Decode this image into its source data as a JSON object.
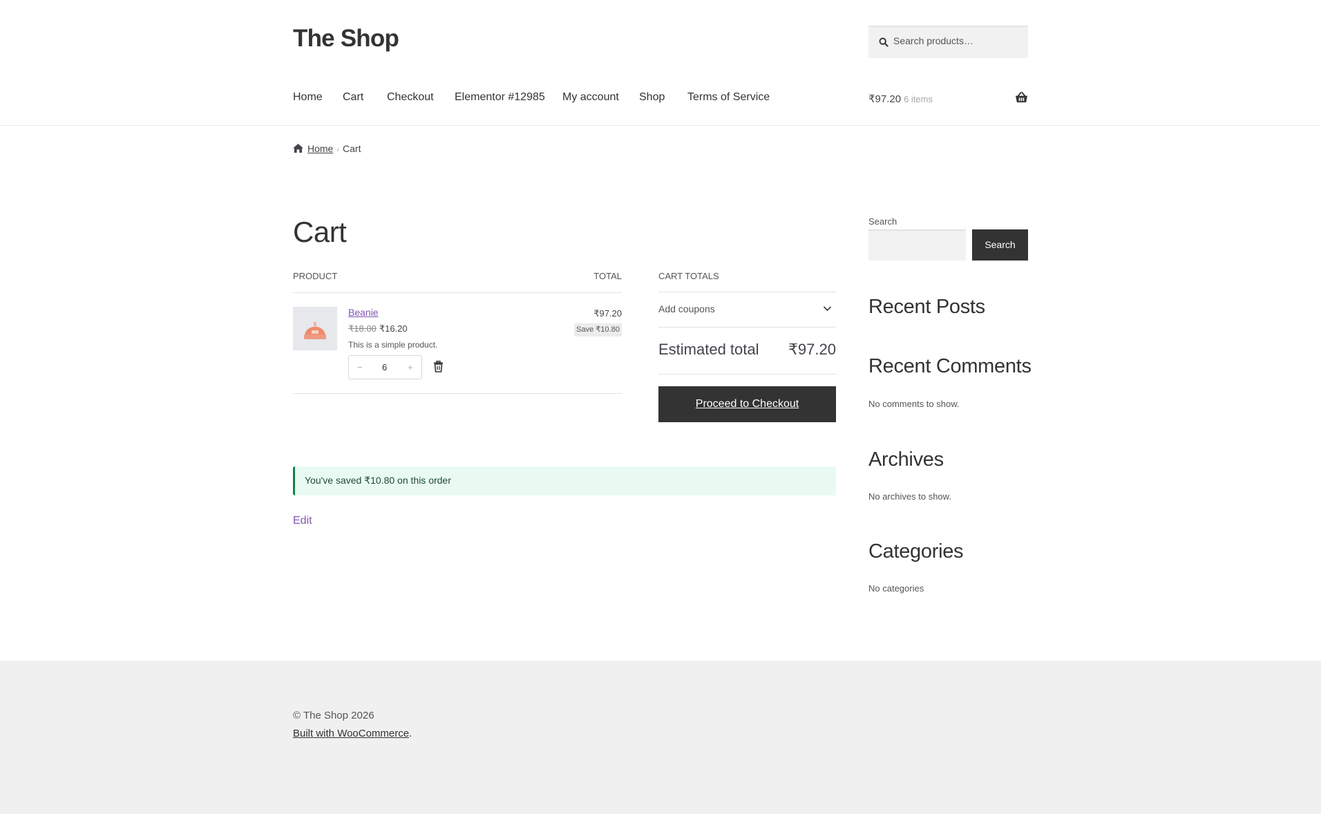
{
  "header": {
    "site_title": "The Shop",
    "search_placeholder": "Search products…",
    "nav": [
      "Home",
      "Cart",
      "Checkout",
      "Elementor #12985",
      "My account",
      "Shop",
      "Terms of Service"
    ],
    "mini_cart": {
      "amount": "₹97.20",
      "count": "6 items"
    }
  },
  "breadcrumb": {
    "home": "Home",
    "current": "Cart"
  },
  "cart": {
    "title": "Cart",
    "col_product": "PRODUCT",
    "col_total": "TOTAL",
    "item": {
      "name": "Beanie",
      "regular_price": "₹18.00",
      "sale_price": "₹16.20",
      "description": "This is a simple product.",
      "quantity": "6",
      "qty_minus": "−",
      "qty_plus": "+",
      "line_total": "₹97.20",
      "save_badge": "Save ₹10.80"
    }
  },
  "totals": {
    "heading": "CART TOTALS",
    "coupons": "Add coupons",
    "estimated_label": "Estimated total",
    "estimated_value": "₹97.20",
    "checkout_label": "Proceed to Checkout"
  },
  "notice": "You've saved ₹10.80 on this order",
  "edit_link": "Edit",
  "sidebar": {
    "search_label": "Search",
    "search_button": "Search",
    "recent_posts": "Recent Posts",
    "recent_comments": "Recent Comments",
    "recent_comments_text": "No comments to show.",
    "archives": "Archives",
    "archives_text": "No archives to show.",
    "categories": "Categories",
    "categories_text": "No categories"
  },
  "footer": {
    "copyright": "© The Shop 2026",
    "built_link": "Built with WooCommerce",
    "built_suffix": "."
  },
  "colors": {
    "accent": "#7f54b3",
    "dark": "#333333",
    "notice_bg": "#e9faf3",
    "notice_border": "#0f834d"
  }
}
